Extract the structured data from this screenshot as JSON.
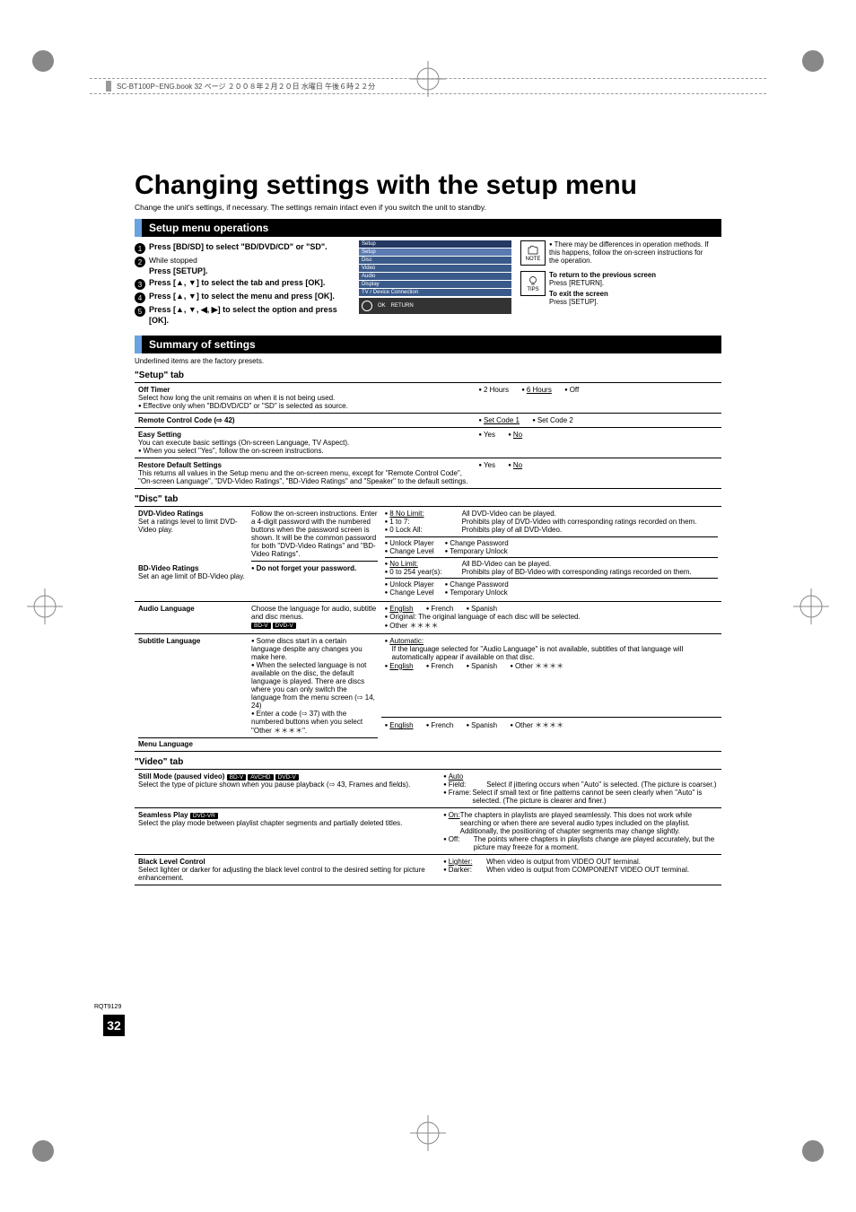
{
  "header": {
    "bookinfo": "SC-BT100P~ENG.book  32 ページ  ２００８年２月２０日  水曜日  午後６時２２分"
  },
  "page": {
    "title": "Changing settings with the setup menu",
    "sub": "Change the unit's settings, if necessary. The settings remain intact even if you switch the unit to standby."
  },
  "ops": {
    "heading": "Setup menu operations",
    "steps": [
      {
        "n": "1",
        "bold": "Press [BD/SD] to select \"BD/DVD/CD\" or \"SD\"."
      },
      {
        "n": "2",
        "small": "While stopped",
        "bold": "Press [SETUP]."
      },
      {
        "n": "3",
        "bold": "Press [▲, ▼] to select the tab and press [OK]."
      },
      {
        "n": "4",
        "bold": "Press [▲, ▼] to select the menu and press [OK]."
      },
      {
        "n": "5",
        "bold": "Press [▲, ▼, ◀, ▶] to select the option and press [OK]."
      }
    ],
    "menu": {
      "title": "Setup",
      "items": [
        "Setup",
        "Disc",
        "Video",
        "Audio",
        "Display",
        "TV / Device Connection"
      ],
      "ok": "OK",
      "return": "RETURN"
    },
    "note": {
      "label": "NOTE",
      "text": "There may be differences in operation methods. If this happens, follow the on-screen instructions for the operation."
    },
    "tips": {
      "label": "TIPS",
      "lines": [
        {
          "bold": "To return to the previous screen",
          "body": "Press [RETURN]."
        },
        {
          "bold": "To exit the screen",
          "body": "Press [SETUP]."
        }
      ]
    }
  },
  "summary": {
    "heading": "Summary of settings",
    "presetNote": "Underlined items are the factory presets."
  },
  "setupTab": {
    "label": "\"Setup\" tab",
    "rows": {
      "offTimer": {
        "title": "Off Timer",
        "desc1": "Select how long the unit remains on when it is not being used.",
        "desc2": "Effective only when \"BD/DVD/CD\" or \"SD\" is selected as source.",
        "opts": [
          "2 Hours",
          "6 Hours",
          "Off"
        ],
        "def": 1
      },
      "remoteCode": {
        "title": "Remote Control Code (⇨ 42)",
        "opts": [
          "Set Code 1",
          "Set Code 2"
        ],
        "def": 0
      },
      "easy": {
        "title": "Easy Setting",
        "desc1": "You can execute basic settings (On-screen Language, TV Aspect).",
        "desc2": "When you select \"Yes\", follow the on-screen instructions.",
        "opts": [
          "Yes",
          "No"
        ],
        "def": 1
      },
      "restore": {
        "title": "Restore Default Settings",
        "desc": "This returns all values in the Setup menu and the on-screen menu, except for \"Remote Control Code\", \"On-screen Language\", \"DVD-Video Ratings\", \"BD-Video Ratings\" and \"Speaker\" to the default settings.",
        "opts": [
          "Yes",
          "No"
        ],
        "def": 1
      }
    }
  },
  "discTab": {
    "label": "\"Disc\" tab",
    "dvdRatings": {
      "title": "DVD-Video Ratings",
      "sub": "Set a ratings level to limit DVD-Video play.",
      "instr1": "Follow the on-screen instructions. Enter a 4-digit password with the numbered buttons when the password screen is shown. It will be the common password for both \"DVD-Video Ratings\" and \"BD-Video Ratings\".",
      "line1lab": "8 No Limit:",
      "line1": "All DVD-Video can be played.",
      "line2lab": "1 to 7:",
      "line2": "Prohibits play of DVD-Video with corresponding ratings recorded on them.",
      "line3lab": "0 Lock All:",
      "line3": "Prohibits play of all DVD-Video.",
      "extra": [
        "Unlock Player",
        "Change Level",
        "Change Password",
        "Temporary Unlock"
      ]
    },
    "bdRatings": {
      "title": "BD-Video Ratings",
      "sub": "Set an age limit of BD-Video play.",
      "instr2": "Do not forget your password.",
      "line1lab": "No Limit:",
      "line1": "All BD-Video can be played.",
      "line2lab": "0 to 254 year(s):",
      "line2": "Prohibits play of BD-Video with corresponding ratings recorded on them.",
      "extra": [
        "Unlock Player",
        "Change Level",
        "Change Password",
        "Temporary Unlock"
      ]
    },
    "audioLang": {
      "title": "Audio Language",
      "desc": "Choose the language for audio, subtitle and disc menus.",
      "opts": [
        "English",
        "French",
        "Spanish"
      ],
      "def": 0,
      "orig": "Original: The original language of each disc will be selected.",
      "other": "Other ＊＊＊＊"
    },
    "subLang": {
      "title": "Subtitle Language",
      "desc": [
        "Some discs start in a certain language despite any changes you make here.",
        "When the selected language is not available on the disc, the default language is played. There are discs where you can only switch the language from the menu screen (⇨ 14, 24)",
        "Enter a code (⇨ 37) with the numbered buttons when you select \"Other ＊＊＊＊\"."
      ],
      "auto": "Automatic:",
      "autoDesc": "If the language selected for \"Audio Language\" is not available, subtitles of that language will automatically appear if available on that disc.",
      "opts": [
        "English",
        "French",
        "Spanish",
        "Other ＊＊＊＊"
      ],
      "def": 0
    },
    "menuLang": {
      "title": "Menu Language",
      "opts": [
        "English",
        "French",
        "Spanish",
        "Other ＊＊＊＊"
      ],
      "def": 0
    }
  },
  "videoTab": {
    "label": "\"Video\" tab",
    "still": {
      "title": "Still Mode (paused video)",
      "badges": [
        "BD-V",
        "AVCHD",
        "DVD-V"
      ],
      "desc": "Select the type of picture shown when you pause playback (⇨ 43, Frames and fields).",
      "autoLab": "Auto",
      "fieldLab": "Field:",
      "field": "Select if jittering occurs when \"Auto\" is selected. (The picture is coarser.)",
      "frameLab": "Frame:",
      "frame": "Select if small text or fine patterns cannot be seen clearly when \"Auto\" is selected. (The picture is clearer and finer.)"
    },
    "seamless": {
      "title": "Seamless Play",
      "badges": [
        "DVD-VR"
      ],
      "desc": "Select the play mode between playlist chapter segments and partially deleted titles.",
      "onLab": "On:",
      "on": "The chapters in playlists are played seamlessly. This does not work while searching or when there are several audio types included on the playlist. Additionally, the positioning of chapter segments may change slightly.",
      "offLab": "Off:",
      "off": "The points where chapters in playlists change are played accurately, but the picture may freeze for a moment."
    },
    "black": {
      "title": "Black Level Control",
      "desc": "Select lighter or darker for adjusting the black level control to the desired setting for picture enhancement.",
      "lighterLab": "Lighter:",
      "lighter": "When video is output from VIDEO OUT terminal.",
      "darkerLab": "Darker:",
      "darker": "When video is output from COMPONENT VIDEO OUT terminal."
    }
  },
  "footer": {
    "code": "RQT9129",
    "page": "32"
  }
}
